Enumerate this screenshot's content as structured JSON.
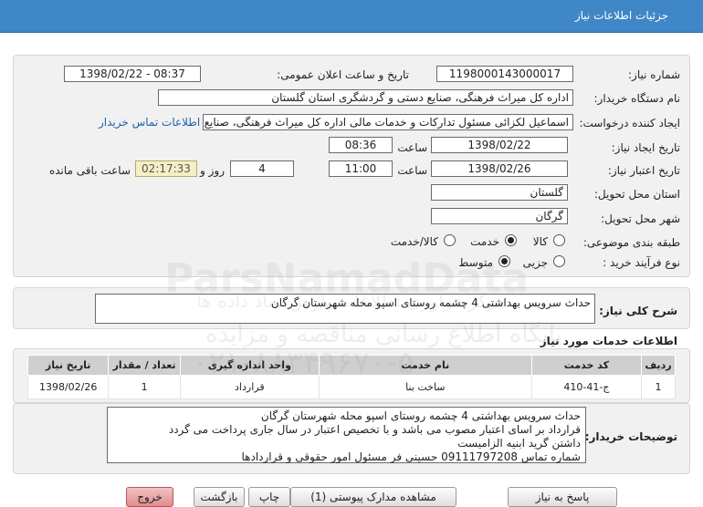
{
  "header": {
    "title": "جزئیات اطلاعات نیاز"
  },
  "fields": {
    "need_number_label": "شماره نیاز:",
    "need_number": "1198000143000017",
    "announce_label": "تاریخ و ساعت اعلان عمومی:",
    "announce_value": "1398/02/22 - 08:37",
    "buyer_label": "نام دستگاه خریدار:",
    "buyer_value": "اداره کل میراث فرهنگی، صنایع دستی و گردشگری استان گلستان",
    "requester_label": "ایجاد کننده درخواست:",
    "requester_value": "اسماعیل لکزائی مسئول تدارکات و خدمات مالی اداره کل میراث فرهنگی، صنایع",
    "contact_link": "اطلاعات تماس خریدار",
    "created_label": "تاریخ ایجاد نیاز:",
    "created_date": "1398/02/22",
    "time_label": "ساعت",
    "created_time": "08:36",
    "validity_label": "تاریخ اعتبار نیاز:",
    "validity_date": "1398/02/26",
    "validity_time": "11:00",
    "days_value": "4",
    "days_label": "روز و",
    "remaining_time": "02:17:33",
    "remaining_label": "ساعت باقی مانده",
    "province_label": "استان محل تحویل:",
    "province_value": "گلستان",
    "city_label": "شهر محل تحویل:",
    "city_value": "گرگان",
    "category_label": "طبقه بندی موضوعی:",
    "category_options": [
      "کالا",
      "خدمت",
      "کالا/خدمت"
    ],
    "category_selected": "خدمت",
    "process_label": "نوع فرآیند خرید :",
    "process_options": [
      "جزیی",
      "متوسط"
    ],
    "process_selected": "متوسط"
  },
  "summary": {
    "label": "شرح کلی نیاز:",
    "value": "حداث سرویس بهداشتی 4 چشمه روستای اسپو محله شهرستان گرگان"
  },
  "services": {
    "title": "اطلاعات خدمات مورد نیاز",
    "columns": [
      "ردیف",
      "کد خدمت",
      "نام خدمت",
      "واحد اندازه گیری",
      "تعداد / مقدار",
      "تاریخ نیاز"
    ],
    "rows": [
      [
        "1",
        "ج-41-410",
        "ساخت بنا",
        "قرارداد",
        "1",
        "1398/02/26"
      ]
    ]
  },
  "notes": {
    "label": "توضیحات خریدار:",
    "lines": [
      "حداث سرویس بهداشتی 4 چشمه روستای اسپو محله شهرستان گرگان",
      "قرارداد بر اسای اعتبار مصوب می باشد و با تخصیص اعتبار در  سال جاری پرداخت می گردد",
      "داشتن گرید ابنیه الزامیست",
      "شماره تماس 09111797208 حسینی فر مسئول امور حقوقی و قراردادها"
    ]
  },
  "buttons": {
    "reply": "پاسخ به نیاز",
    "view_docs": "مشاهده مدارک پیوستی (1)",
    "print": "چاپ",
    "back": "بازگشت",
    "exit": "خروج"
  },
  "watermark": {
    "line1": "پایگاه اطلاع رسانی مناقصه و مزایده",
    "line2": "۰۲۱-۸۸۳۴۹۶۷۰-۵",
    "line3": "ParsNamadData",
    "line4": "مرکز فراوری اطلاعات پارس نماد داده ها"
  },
  "colors": {
    "header": "#3f87c6",
    "link": "#1f5fb0",
    "remaining_bg": "#f6efc5"
  }
}
